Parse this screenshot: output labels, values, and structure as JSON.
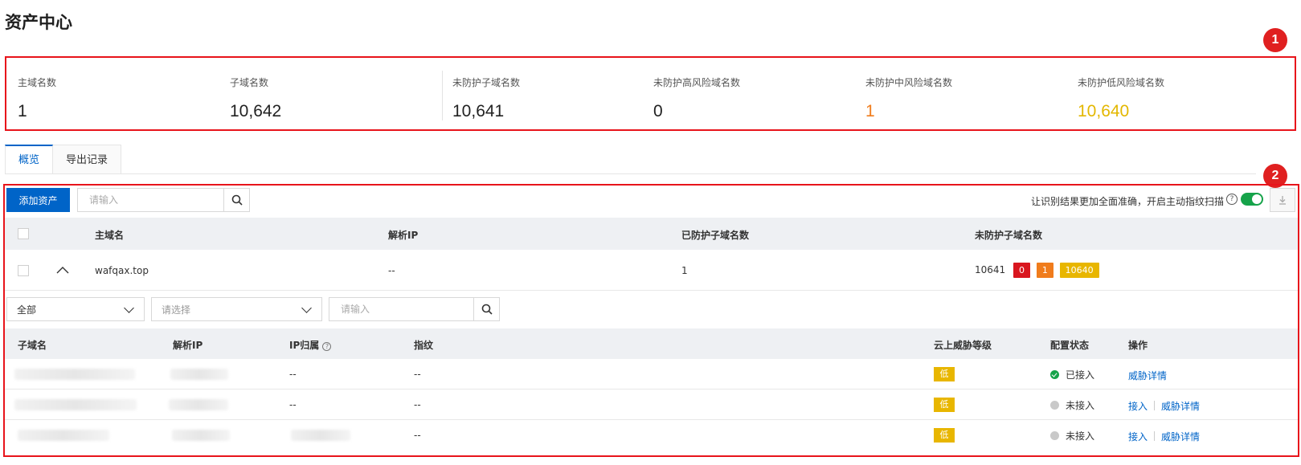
{
  "page": {
    "title": "资产中心"
  },
  "callouts": [
    "1",
    "2"
  ],
  "stats": [
    {
      "label": "主域名数",
      "value": "1",
      "color": "#222222"
    },
    {
      "label": "子域名数",
      "value": "10,642",
      "color": "#222222"
    },
    {
      "label": "未防护子域名数",
      "value": "10,641",
      "color": "#222222"
    },
    {
      "label": "未防护高风险域名数",
      "value": "0",
      "color": "#222222"
    },
    {
      "label": "未防护中风险域名数",
      "value": "1",
      "color": "#f07c1c"
    },
    {
      "label": "未防护低风险域名数",
      "value": "10,640",
      "color": "#e3b700"
    }
  ],
  "tabs": [
    {
      "label": "概览",
      "active": true
    },
    {
      "label": "导出记录",
      "active": false
    }
  ],
  "toolbar": {
    "add_asset": "添加资产",
    "search_placeholder": "请输入",
    "scan_hint": "让识别结果更加全面准确，开启主动指纹扫描",
    "scan_enabled": true
  },
  "main_table": {
    "columns": [
      "主域名",
      "解析IP",
      "已防护子域名数",
      "未防护子域名数"
    ],
    "row": {
      "domain": "wafqax.top",
      "ip": "--",
      "protected": "1",
      "unprotected": "10641",
      "badges": [
        {
          "value": "0",
          "color": "#d9161f"
        },
        {
          "value": "1",
          "color": "#f07c1c"
        },
        {
          "value": "10640",
          "color": "#e8b600"
        }
      ]
    }
  },
  "filters": {
    "scope_select": "全部",
    "type_select_placeholder": "请选择",
    "search_placeholder": "请输入"
  },
  "sub_table": {
    "columns": [
      "子域名",
      "解析IP",
      "IP归属",
      "指纹",
      "云上威胁等级",
      "配置状态",
      "操作"
    ],
    "rows": [
      {
        "ip_owner": "--",
        "fingerprint": "--",
        "level": "低",
        "status": "已接入",
        "status_ok": true,
        "actions": [
          "威胁详情"
        ]
      },
      {
        "ip_owner": "--",
        "fingerprint": "--",
        "level": "低",
        "status": "未接入",
        "status_ok": false,
        "actions": [
          "接入",
          "威胁详情"
        ]
      },
      {
        "ip_owner": "",
        "fingerprint": "--",
        "level": "低",
        "status": "未接入",
        "status_ok": false,
        "actions": [
          "接入",
          "威胁详情"
        ]
      }
    ]
  }
}
